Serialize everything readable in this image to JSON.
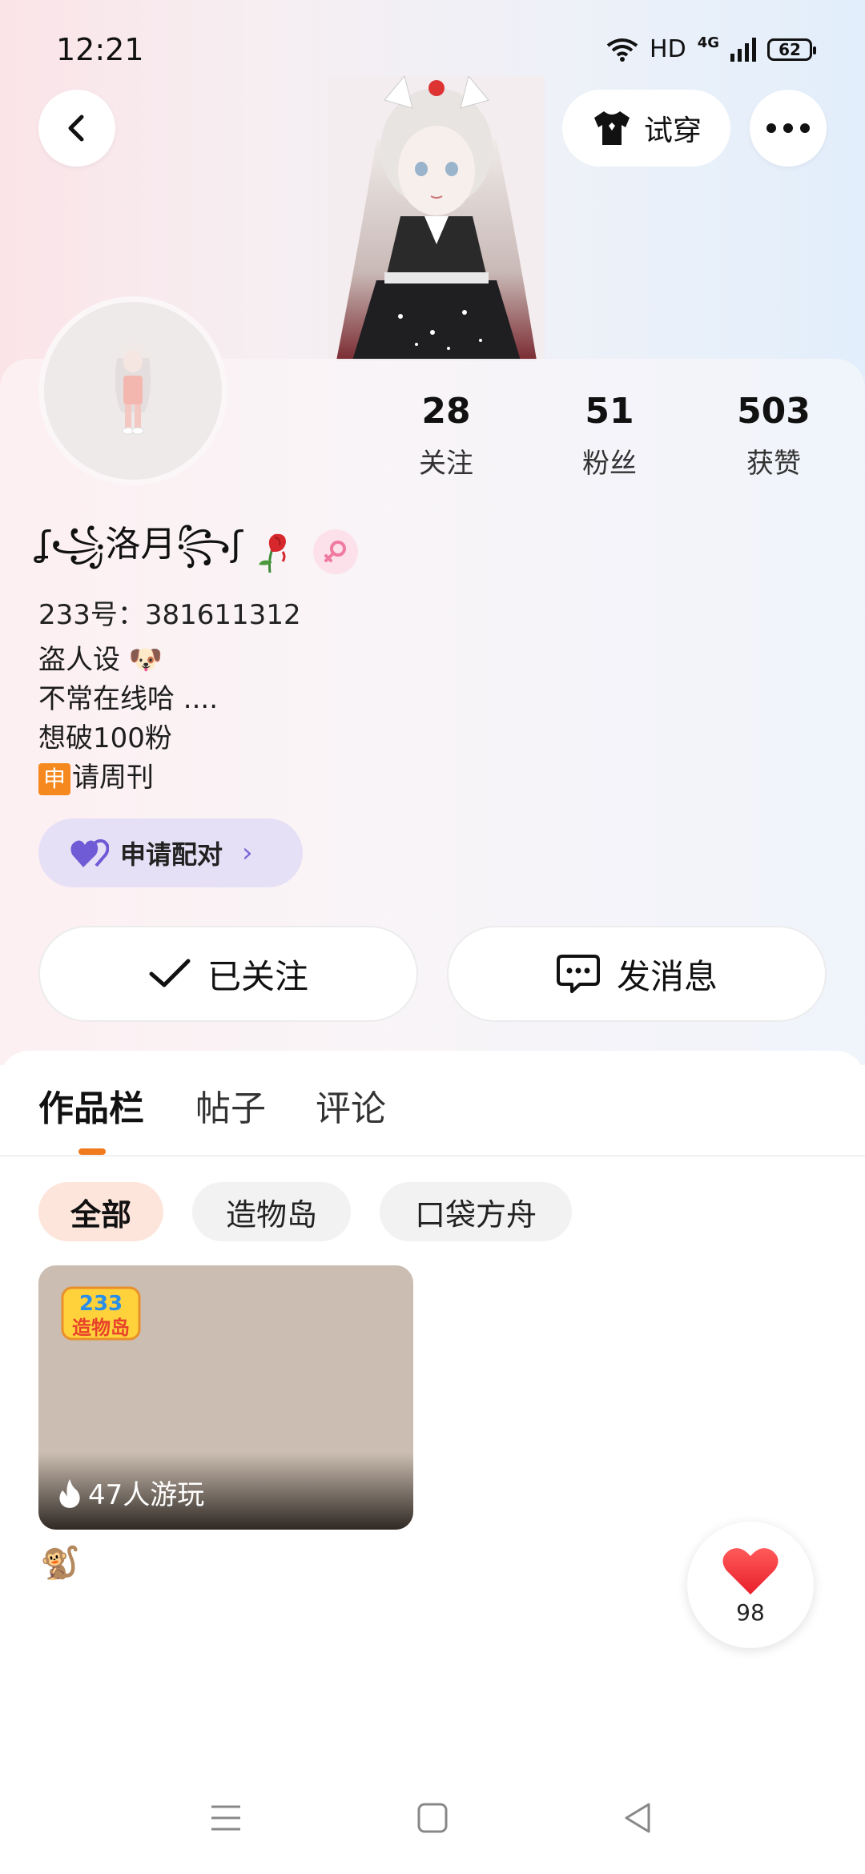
{
  "status_bar": {
    "time": "12:21",
    "hd": "HD",
    "network": "4G",
    "battery": "62"
  },
  "header": {
    "try_on_label": "试穿"
  },
  "stats": [
    {
      "value": "28",
      "label": "关注"
    },
    {
      "value": "51",
      "label": "粉丝"
    },
    {
      "value": "503",
      "label": "获赞"
    }
  ],
  "profile": {
    "nickname": "ʆ꧁洛月꧂ʃ",
    "uid_line": "233号：381611312",
    "bio": [
      "盗人设 🐶",
      "不常在线哈 ....",
      "想破100粉",
      "请周刊"
    ],
    "bio_badge": "申"
  },
  "pair_button": {
    "label": "申请配对"
  },
  "actions": {
    "follow_label": "已关注",
    "message_label": "发消息"
  },
  "tabs": [
    {
      "label": "作品栏",
      "active": true
    },
    {
      "label": "帖子",
      "active": false
    },
    {
      "label": "评论",
      "active": false
    }
  ],
  "filters": [
    {
      "label": "全部",
      "active": true
    },
    {
      "label": "造物岛",
      "active": false
    },
    {
      "label": "口袋方舟",
      "active": false
    }
  ],
  "works": [
    {
      "plays": "47人游玩",
      "logo_text_top": "233",
      "logo_text_bottom": "造物岛"
    }
  ],
  "like_float": {
    "count": "98"
  },
  "colors": {
    "accent": "#f07a1c",
    "pair_bg": "#e6e0f6",
    "pair_heart": "#7a68d8",
    "like_red": "#f0303a"
  }
}
